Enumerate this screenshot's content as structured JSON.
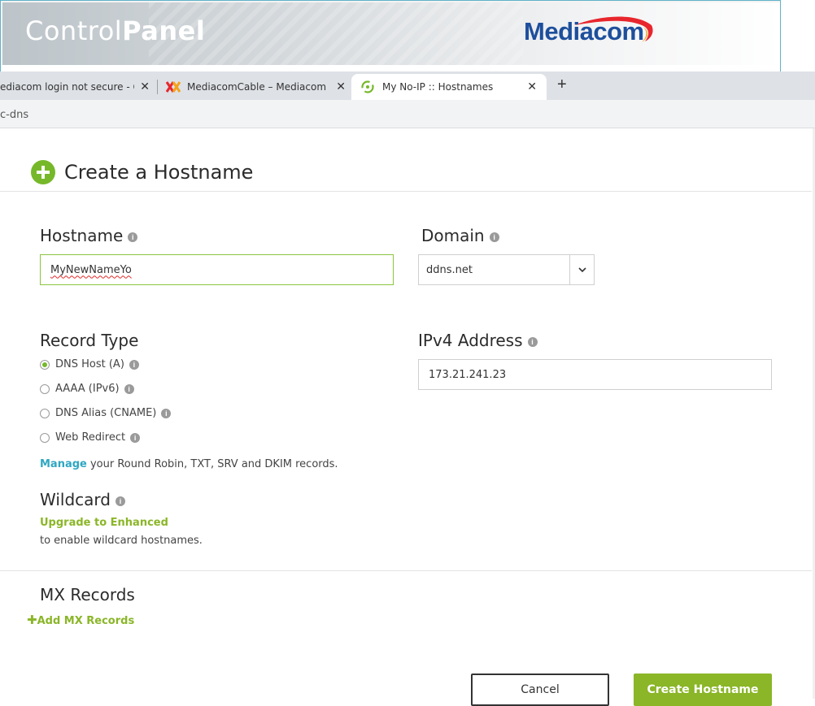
{
  "mediacom": {
    "control_panel_light": "Control",
    "control_panel_bold": "Panel",
    "logo_text": "Mediacom"
  },
  "browser": {
    "tabs": [
      {
        "label": "ediacom login not secure - Goo",
        "icon": "google-icon",
        "active": false
      },
      {
        "label": "MediacomCable – Mediacom Co",
        "icon": "mediacom-icon",
        "active": false
      },
      {
        "label": "My No-IP :: Hostnames",
        "icon": "noip-icon",
        "active": true
      }
    ],
    "new_tab": "+",
    "address_fragment": "c-dns"
  },
  "form": {
    "title": "Create a Hostname",
    "hostname": {
      "label": "Hostname",
      "value": "MyNewNameYo"
    },
    "domain": {
      "label": "Domain",
      "value": "ddns.net"
    },
    "record_type": {
      "label": "Record Type",
      "options": [
        "DNS Host (A)",
        "AAAA (IPv6)",
        "DNS Alias (CNAME)",
        "Web Redirect"
      ],
      "selected": "DNS Host (A)"
    },
    "ipv4": {
      "label": "IPv4 Address",
      "value": "173.21.241.23"
    },
    "manage": {
      "link": "Manage",
      "text": " your Round Robin, TXT, SRV and DKIM records."
    },
    "wildcard": {
      "label": "Wildcard",
      "upgrade_link": "Upgrade to Enhanced",
      "note": "to enable wildcard hostnames."
    },
    "mx": {
      "label": "MX Records",
      "add_link": "Add MX Records"
    },
    "buttons": {
      "cancel": "Cancel",
      "create": "Create Hostname"
    }
  },
  "colors": {
    "accent_green": "#8ab627",
    "link_blue": "#2fa7c2",
    "mediacom_blue": "#1d4f9c"
  }
}
